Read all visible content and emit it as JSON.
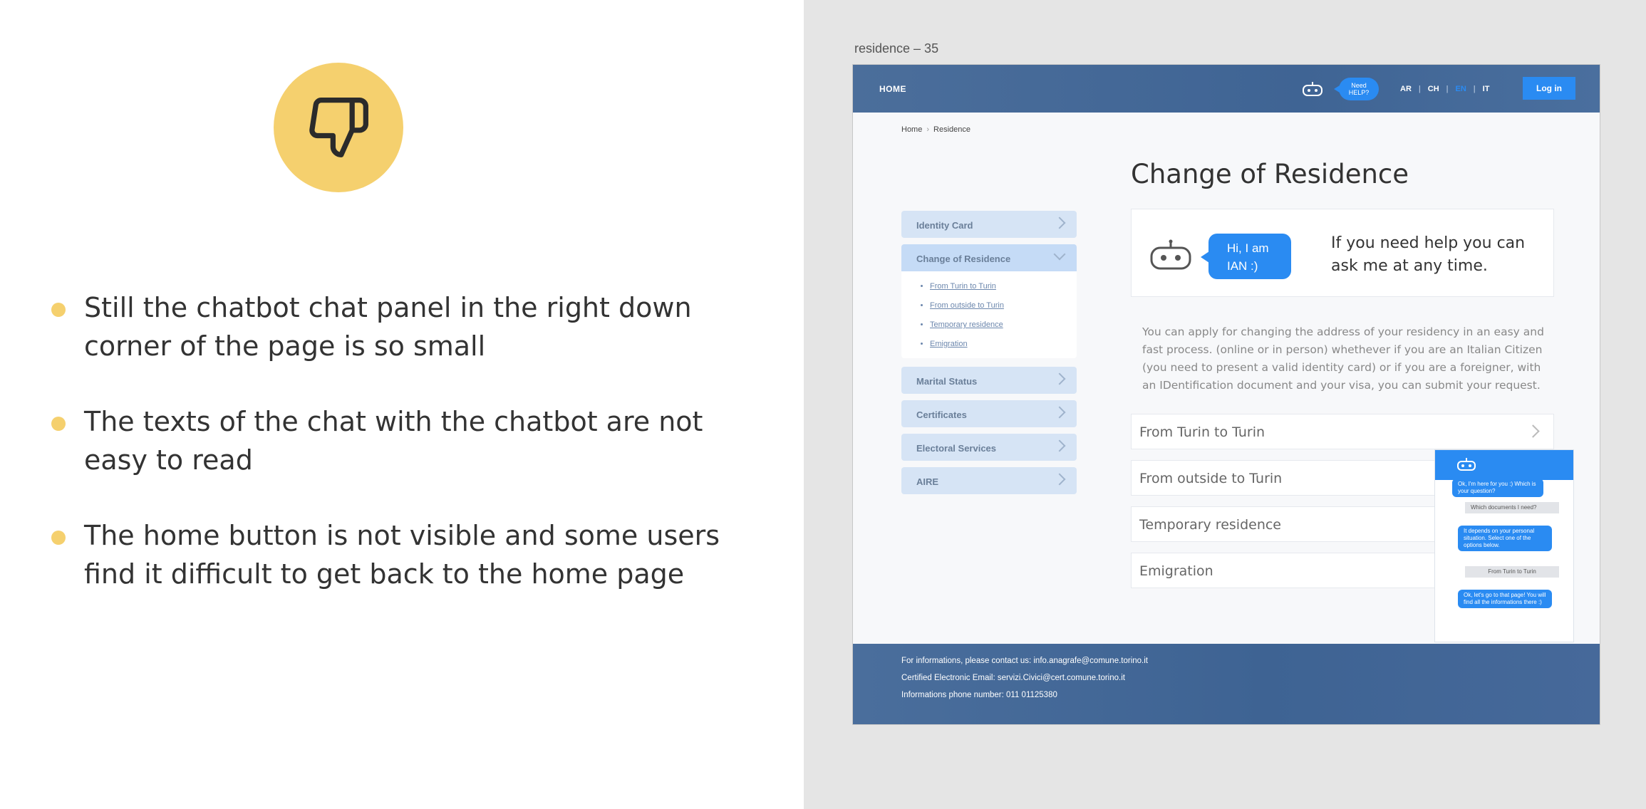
{
  "slide": {
    "bullets": [
      "Still the chatbot chat panel in the right down corner of the page is so small",
      "The texts of the chat with the chatbot are not easy to read",
      "The home button is not visible and some users find it difficult to get back to the home page"
    ],
    "icon": "thumbs-down-icon",
    "accent_color": "#f5d06e"
  },
  "artboard": {
    "label": "residence – 35"
  },
  "site": {
    "nav": {
      "home": "HOME",
      "need_help_1": "Need",
      "need_help_2": "HELP?",
      "langs": [
        "AR",
        "CH",
        "EN",
        "IT"
      ],
      "login": "Log in"
    },
    "breadcrumb": [
      "Home",
      "Residence"
    ],
    "title": "Change of Residence",
    "sidebar": [
      {
        "label": "Identity Card"
      },
      {
        "label": "Change of Residence"
      },
      {
        "label": "Marital Status"
      },
      {
        "label": "Certificates"
      },
      {
        "label": "Electoral Services"
      },
      {
        "label": "AIRE"
      }
    ],
    "subitems": [
      "From Turin to Turin",
      "From outside to Turin",
      "Temporary residence",
      "Emigration"
    ],
    "bot_card": {
      "bubble_1": "Hi, I am",
      "bubble_2": "IAN :)",
      "help": "If you need help you can ask me at any time."
    },
    "description": "You can apply for changing the address of your residency in an easy and fast process. (online or in person) whethever if you are an Italian Citizen (you need to present a valid identity card) or if you are a foreigner, with an IDentification document and your visa, you can submit your request.",
    "options": [
      "From Turin to Turin",
      "From outside to Turin",
      "Temporary residence",
      "Emigration"
    ],
    "chat": {
      "m1": "Ok, I'm here for you :) Which is your question?",
      "m2": "Which documents I need?",
      "m3": "It depends on your personal situation. Select one of the options below.",
      "m4": "From Turin to Turin",
      "m5": "Ok, let's go to that page! You will find all the informations there :)"
    },
    "footer": {
      "line1": "For informations, please contact us: info.anagrafe@comune.torino.it",
      "line2": "Certified Electronic Email: servizi.Civici@cert.comune.torino.it",
      "line3": "Informations phone number: 011 01125380"
    },
    "colors": {
      "primary": "#2a8bf2",
      "header": "#3f6494"
    }
  }
}
